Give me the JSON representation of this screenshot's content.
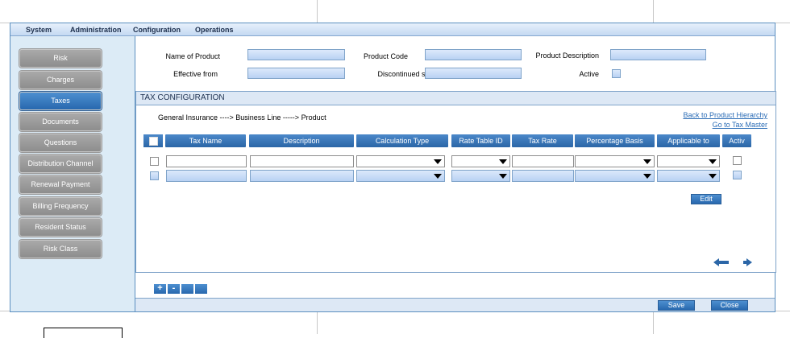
{
  "menu": [
    "System",
    "Administration",
    "Configuration",
    "Operations"
  ],
  "sidebar": {
    "items": [
      {
        "label": "Risk"
      },
      {
        "label": "Charges"
      },
      {
        "label": "Taxes"
      },
      {
        "label": "Documents"
      },
      {
        "label": "Questions"
      },
      {
        "label": "Distribution Channel"
      },
      {
        "label": "Renewal Payment"
      },
      {
        "label": "Billing Frequency"
      },
      {
        "label": "Resident Status"
      },
      {
        "label": "Risk Class"
      }
    ],
    "active_index": 2
  },
  "product_form": {
    "name_label": "Name of Product",
    "code_label": "Product Code",
    "description_label": "Product Description",
    "effective_label": "Effective from",
    "discontinued_label": "Discontinued since",
    "active_label": "Active"
  },
  "tax_panel": {
    "title": "TAX CONFIGURATION",
    "breadcrumb": "General Insurance ----> Business Line -----> Product",
    "link_back": "Back to Product Hierarchy",
    "link_tax_master": "Go to Tax Master",
    "columns": [
      "Tax Name",
      "Description",
      "Calculation Type",
      "Rate Table ID",
      "Tax Rate",
      "Percentage Basis",
      "Applicable to",
      "Activ"
    ],
    "edit_label": "Edit"
  },
  "toolbar": {
    "add_label": "+",
    "remove_label": "-",
    "save_label": "Save",
    "close_label": "Close"
  },
  "colors": {
    "accent": "#2b66a7",
    "sidebar_bg": "#dcebf6",
    "inactive_btn": "#8d8d8d"
  }
}
